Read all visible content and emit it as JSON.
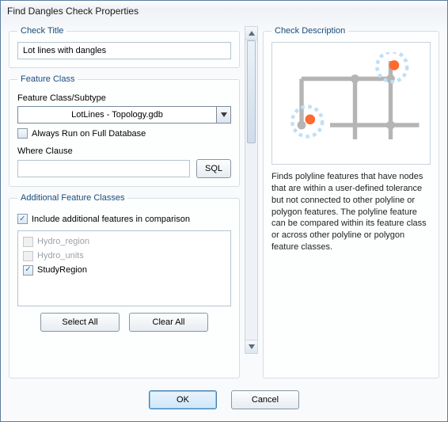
{
  "window": {
    "title": "Find Dangles Check Properties"
  },
  "left": {
    "check_title_group": "Check Title",
    "check_title_value": "Lot lines with dangles",
    "feature_class_group": "Feature Class",
    "feature_class_sub": "Feature Class/Subtype",
    "feature_class_value": "LotLines  -  Topology.gdb",
    "always_run_label": "Always Run on Full Database",
    "where_clause_label": "Where Clause",
    "where_clause_value": "",
    "sql_button": "SQL",
    "additional_group": "Additional Feature Classes",
    "include_additional_label": "Include additional features in comparison",
    "items": [
      {
        "label": "Hydro_region",
        "checked": false,
        "enabled": false
      },
      {
        "label": "Hydro_units",
        "checked": false,
        "enabled": false
      },
      {
        "label": "StudyRegion",
        "checked": true,
        "enabled": true
      }
    ],
    "select_all": "Select All",
    "clear_all": "Clear All"
  },
  "right": {
    "group": "Check Description",
    "text": "Finds polyline features that have nodes that are within a user-defined tolerance but not connected to other polyline or polygon features.  The polyline feature can be compared within its feature class or across other polyline or polygon feature classes."
  },
  "buttons": {
    "ok": "OK",
    "cancel": "Cancel"
  },
  "icons": {
    "chevron_down": "chevron-down-icon",
    "up": "caret-up-icon",
    "down": "caret-down-icon"
  }
}
